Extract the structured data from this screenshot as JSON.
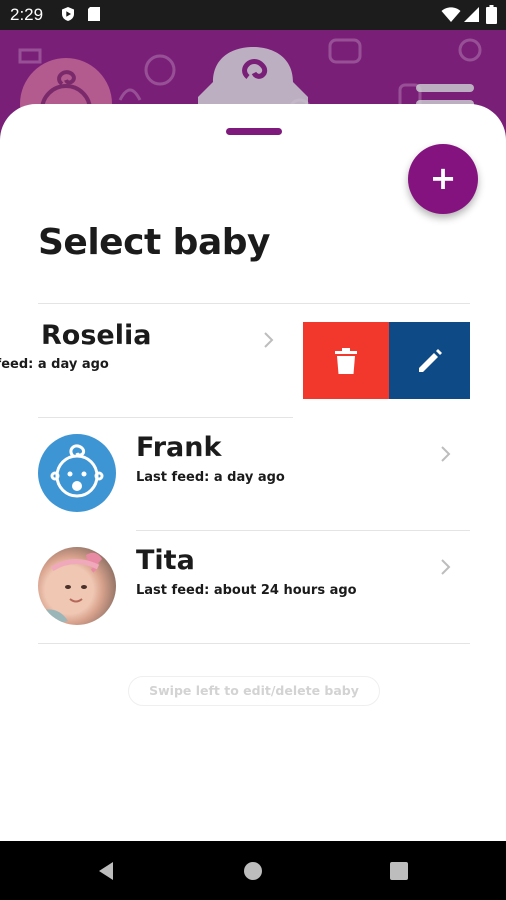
{
  "status_bar": {
    "time": "2:29",
    "icons": [
      "play-protect-icon",
      "sd-card-icon",
      "wifi-icon",
      "signal-icon",
      "battery-icon"
    ]
  },
  "header": {
    "icons": [
      "baby-avatar-icon",
      "baby-logo-icon",
      "menu-icon"
    ]
  },
  "sheet": {
    "title": "Select baby",
    "add_button_label": "+",
    "babies": [
      {
        "name": "Roselia",
        "last_feed": "Last feed: a day ago",
        "swiped": true,
        "avatar": "none"
      },
      {
        "name": "Frank",
        "last_feed": "Last feed: a day ago",
        "swiped": false,
        "avatar": "baby-face-icon"
      },
      {
        "name": "Tita",
        "last_feed": "Last feed: about 24 hours ago",
        "swiped": false,
        "avatar": "baby-photo"
      }
    ],
    "swipe_actions": [
      "delete-icon",
      "edit-icon"
    ],
    "hint": "Swipe left to edit/delete baby"
  },
  "colors": {
    "brand_purple": "#7a1f78",
    "fab": "#84137f",
    "delete": "#f2382c",
    "edit": "#0e4a86",
    "avatar_blue": "#3d95d4"
  },
  "nav_bar": {
    "buttons": [
      "back-icon",
      "home-icon",
      "recents-icon"
    ]
  }
}
